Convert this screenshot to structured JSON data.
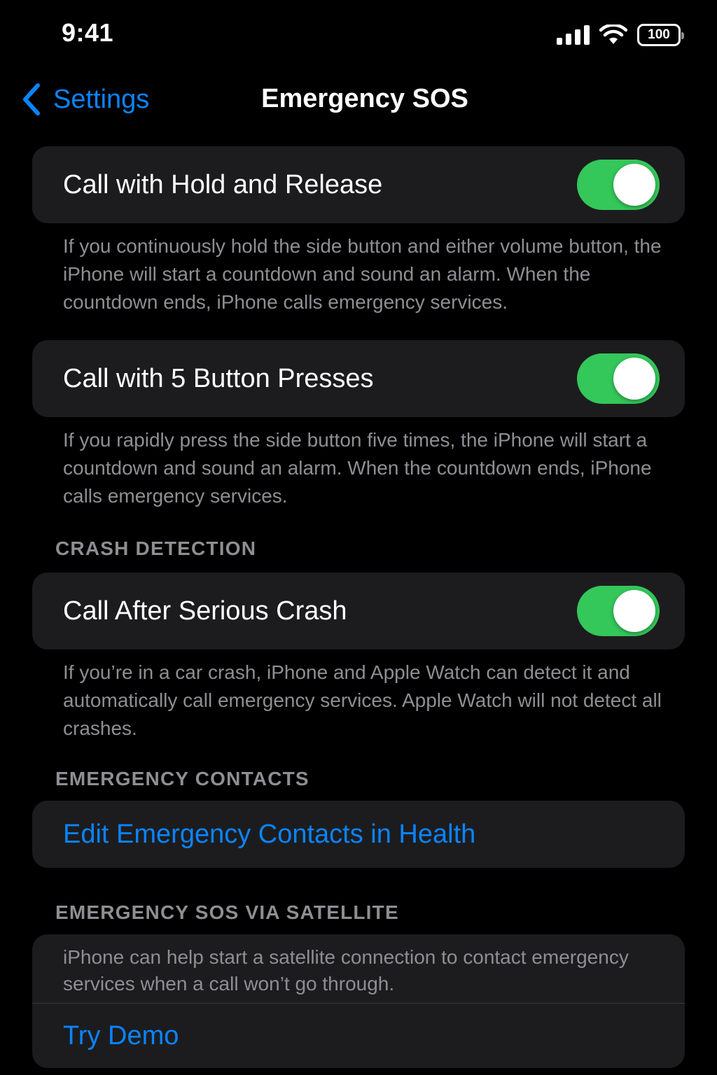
{
  "status_bar": {
    "time": "9:41",
    "battery": "100",
    "icons": [
      "signal-icon",
      "wifi-icon",
      "battery-icon"
    ]
  },
  "nav": {
    "back_label": "Settings",
    "title": "Emergency SOS",
    "back_icon": "chevron-left-icon"
  },
  "settings": {
    "hold_release": {
      "label": "Call with Hold and Release",
      "enabled": true,
      "footer": "If you continuously hold the side button and either volume button, the iPhone will start a countdown and sound an alarm. When the countdown ends, iPhone calls emergency services."
    },
    "five_presses": {
      "label": "Call with 5 Button Presses",
      "enabled": true,
      "footer": "If you rapidly press the side button five times, the iPhone will start a countdown and sound an alarm. When the countdown ends, iPhone calls emergency services."
    }
  },
  "crash_detection": {
    "header": "CRASH DETECTION",
    "label": "Call After Serious Crash",
    "enabled": true,
    "footer": "If you’re in a car crash, iPhone and Apple Watch can detect it and automatically call emergency services. Apple Watch will not detect all crashes."
  },
  "emergency_contacts": {
    "header": "EMERGENCY CONTACTS",
    "link": "Edit Emergency Contacts in Health"
  },
  "satellite": {
    "header": "EMERGENCY SOS VIA SATELLITE",
    "description": "iPhone can help start a satellite connection to contact emergency services when a call won’t go through.",
    "demo_link": "Try Demo"
  },
  "colors": {
    "background": "#000000",
    "cell": "#1c1c1e",
    "accent_blue": "#0a84ff",
    "toggle_on": "#34c759",
    "secondary_text": "#8e8e93"
  }
}
